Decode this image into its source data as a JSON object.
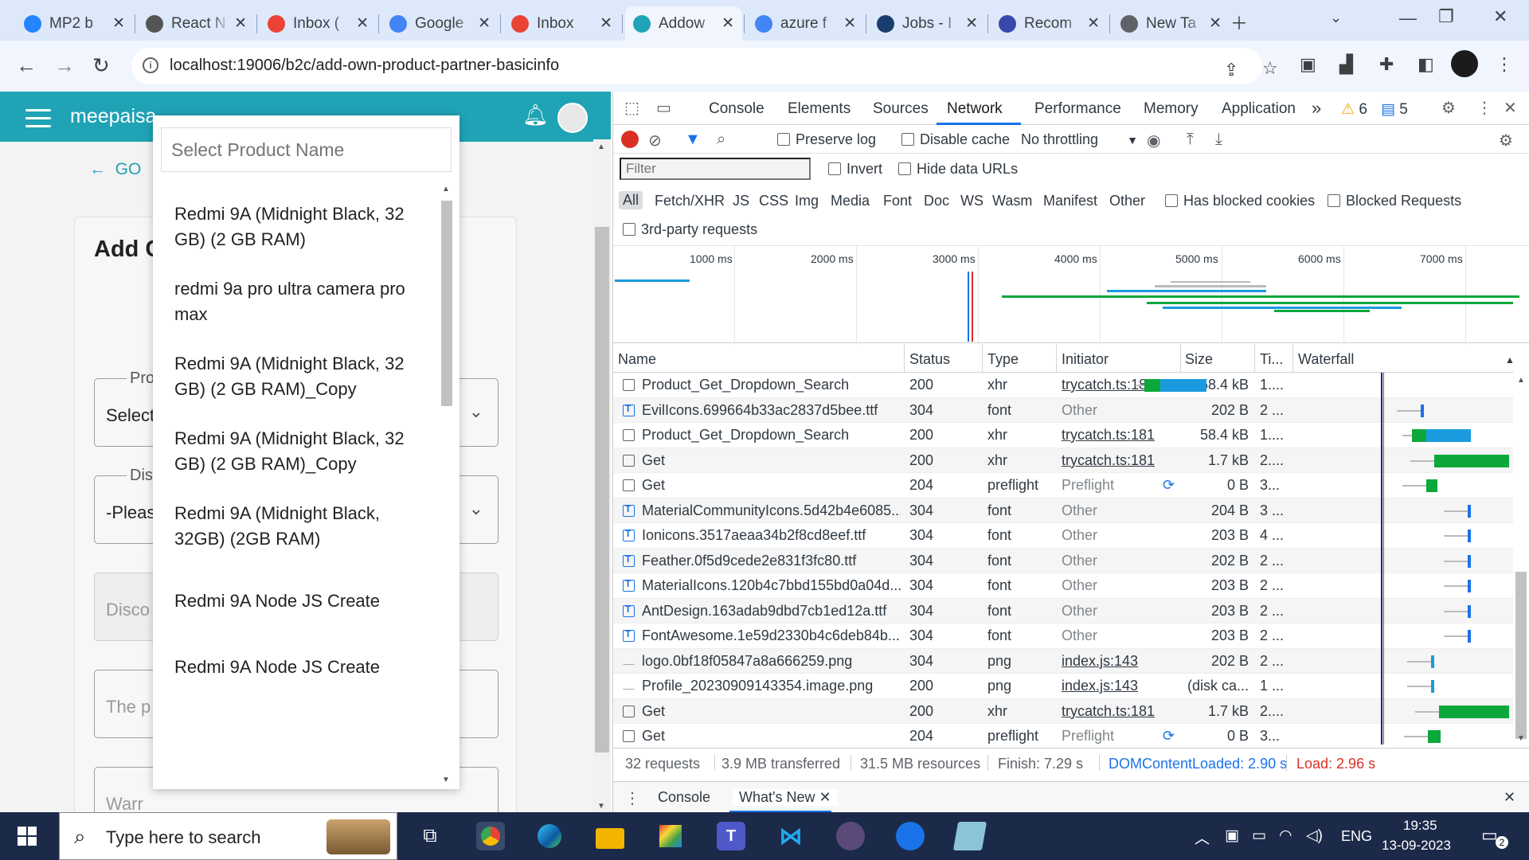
{
  "browser": {
    "tabs": [
      {
        "title": "MP2 b",
        "icon_name": "jira-icon",
        "color": "#2684ff"
      },
      {
        "title": "React N",
        "icon_name": "chatgpt-icon",
        "color": "#555555"
      },
      {
        "title": "Inbox (",
        "icon_name": "gmail-icon",
        "color": "#ea4335"
      },
      {
        "title": "Google",
        "icon_name": "google-icon",
        "color": "#4285f4"
      },
      {
        "title": "Inbox",
        "icon_name": "gmail-icon",
        "color": "#ea4335"
      },
      {
        "title": "Addow",
        "icon_name": "app-icon",
        "color": "#1fa3b5"
      },
      {
        "title": "azure f",
        "icon_name": "google-icon",
        "color": "#4285f4"
      },
      {
        "title": "Jobs - I",
        "icon_name": "naukri-icon",
        "color": "#1a3d6d"
      },
      {
        "title": "Recom",
        "icon_name": "k-icon",
        "color": "#3949ab"
      },
      {
        "title": "New Ta",
        "icon_name": "chrome-icon",
        "color": "#5f6368"
      }
    ],
    "url": "localhost:19006/b2c/add-own-product-partner-basicinfo"
  },
  "app": {
    "brand": "meepaisa",
    "go_back": "GO",
    "card_title": "Add C",
    "fields": [
      {
        "legend": "Pro",
        "value": "Select"
      },
      {
        "legend": "Dis",
        "value": "-Pleas"
      },
      {
        "legend": "",
        "value": "Disco"
      },
      {
        "legend": "",
        "value": "The p"
      },
      {
        "legend": "",
        "value": "Warr"
      }
    ]
  },
  "dropdown": {
    "placeholder": "Select Product Name",
    "items": [
      "Redmi 9A (Midnight Black, 32 GB)  (2 GB RAM)",
      "redmi 9a pro ultra camera pro max",
      "Redmi 9A (Midnight Black, 32 GB)  (2 GB RAM)_Copy",
      "Redmi 9A (Midnight Black, 32 GB)  (2 GB RAM)_Copy",
      "Redmi 9A (Midnight Black, 32GB)  (2GB RAM)",
      "Redmi 9A Node JS Create",
      "Redmi 9A Node JS Create"
    ]
  },
  "devtools": {
    "tabs": [
      "Console",
      "Elements",
      "Sources",
      "Network",
      "Performance",
      "Memory",
      "Application"
    ],
    "active_tab": "Network",
    "more": "»",
    "warnings": "6",
    "messages": "5",
    "toolbar": {
      "preserve_log": "Preserve log",
      "disable_cache": "Disable cache",
      "throttling": "No throttling"
    },
    "filter_placeholder": "Filter",
    "invert": "Invert",
    "hide_data_urls": "Hide data URLs",
    "types": [
      "All",
      "Fetch/XHR",
      "JS",
      "CSS",
      "Img",
      "Media",
      "Font",
      "Doc",
      "WS",
      "Wasm",
      "Manifest",
      "Other"
    ],
    "has_blocked_cookies": "Has blocked cookies",
    "blocked_requests": "Blocked Requests",
    "third_party": "3rd-party requests",
    "overview_ticks": [
      "1000 ms",
      "2000 ms",
      "3000 ms",
      "4000 ms",
      "5000 ms",
      "6000 ms",
      "7000 ms"
    ],
    "columns": [
      "Name",
      "Status",
      "Type",
      "Initiator",
      "Size",
      "Ti...",
      "Waterfall"
    ],
    "rows": [
      {
        "name": "Product_Get_Dropdown_Search",
        "status": "200",
        "type": "xhr",
        "initiator": "trycatch.ts:181",
        "size": "58.4 kB",
        "time": "1....",
        "icon": "doc",
        "link": true
      },
      {
        "name": "EvilIcons.699664b33ac2837d5bee.ttf",
        "status": "304",
        "type": "font",
        "initiator": "Other",
        "size": "202 B",
        "time": "2 ...",
        "icon": "font",
        "link": false
      },
      {
        "name": "Product_Get_Dropdown_Search",
        "status": "200",
        "type": "xhr",
        "initiator": "trycatch.ts:181",
        "size": "58.4 kB",
        "time": "1....",
        "icon": "doc",
        "link": true
      },
      {
        "name": "Get",
        "status": "200",
        "type": "xhr",
        "initiator": "trycatch.ts:181",
        "size": "1.7 kB",
        "time": "2....",
        "icon": "doc",
        "link": true
      },
      {
        "name": "Get",
        "status": "204",
        "type": "preflight",
        "initiator": "Preflight",
        "size": "0 B",
        "time": "3...",
        "icon": "doc",
        "link": false
      },
      {
        "name": "MaterialCommunityIcons.5d42b4e6085...",
        "status": "304",
        "type": "font",
        "initiator": "Other",
        "size": "204 B",
        "time": "3 ...",
        "icon": "font",
        "link": false
      },
      {
        "name": "Ionicons.3517aeaa34b2f8cd8eef.ttf",
        "status": "304",
        "type": "font",
        "initiator": "Other",
        "size": "203 B",
        "time": "4 ...",
        "icon": "font",
        "link": false
      },
      {
        "name": "Feather.0f5d9cede2e831f3fc80.ttf",
        "status": "304",
        "type": "font",
        "initiator": "Other",
        "size": "202 B",
        "time": "2 ...",
        "icon": "font",
        "link": false
      },
      {
        "name": "MaterialIcons.120b4c7bbd155bd0a04d...",
        "status": "304",
        "type": "font",
        "initiator": "Other",
        "size": "203 B",
        "time": "2 ...",
        "icon": "font",
        "link": false
      },
      {
        "name": "AntDesign.163adab9dbd7cb1ed12a.ttf",
        "status": "304",
        "type": "font",
        "initiator": "Other",
        "size": "203 B",
        "time": "2 ...",
        "icon": "font",
        "link": false
      },
      {
        "name": "FontAwesome.1e59d2330b4c6deb84b...",
        "status": "304",
        "type": "font",
        "initiator": "Other",
        "size": "203 B",
        "time": "2 ...",
        "icon": "font",
        "link": false
      },
      {
        "name": "logo.0bf18f05847a8a666259.png",
        "status": "304",
        "type": "png",
        "initiator": "index.js:143",
        "size": "202 B",
        "time": "2 ...",
        "icon": "img",
        "link": true
      },
      {
        "name": "Profile_20230909143354.image.png",
        "status": "200",
        "type": "png",
        "initiator": "index.js:143",
        "size": "(disk ca...",
        "time": "1 ...",
        "icon": "img",
        "link": true
      },
      {
        "name": "Get",
        "status": "200",
        "type": "xhr",
        "initiator": "trycatch.ts:181",
        "size": "1.7 kB",
        "time": "2....",
        "icon": "doc",
        "link": true
      },
      {
        "name": "Get",
        "status": "204",
        "type": "preflight",
        "initiator": "Preflight",
        "size": "0 B",
        "time": "3...",
        "icon": "doc",
        "link": false
      }
    ],
    "status_bar": {
      "requests": "32 requests",
      "transferred": "3.9 MB transferred",
      "resources": "31.5 MB resources",
      "finish": "Finish: 7.29 s",
      "dom_loaded": "DOMContentLoaded: 2.90 s",
      "load": "Load: 2.96 s"
    },
    "drawer": {
      "console": "Console",
      "whats_new": "What's New"
    },
    "colors": {
      "accent": "#1a73e8",
      "dom_blue": "#1a73e8",
      "load_red": "#d93025",
      "green": "#0ca83b"
    }
  },
  "taskbar": {
    "search": "Type here to search",
    "language": "ENG",
    "time": "19:35",
    "date": "13-09-2023",
    "notifications": "2"
  }
}
